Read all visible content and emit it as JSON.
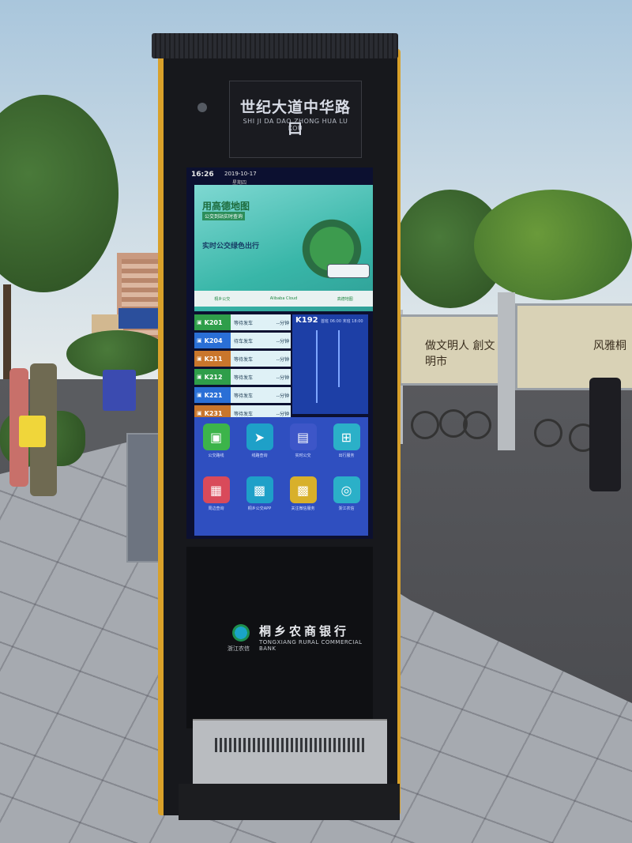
{
  "kiosk": {
    "stop_name_cn": "世纪大道中华路口",
    "stop_name_pinyin": "SHI JI DA DAO ZHONG HUA LU KOU",
    "screen": {
      "time": "16:26",
      "date": "2019-10-17",
      "weekday": "星期四",
      "banner": {
        "headline": "用高德地图",
        "tag": "公交到站实时查询",
        "subline": "实时公交绿色出行",
        "footer_items": [
          "桐乡公交",
          "Alibaba Cloud",
          "高德地图"
        ]
      },
      "routes": [
        {
          "id": "K201",
          "wait": "--分钟",
          "status": "等待发车",
          "color": "#2f9e4a"
        },
        {
          "id": "K204",
          "wait": "--分钟",
          "status": "待车发车",
          "color": "#2a6fd6"
        },
        {
          "id": "K211",
          "wait": "--分钟",
          "status": "等待发车",
          "color": "#c9762c"
        },
        {
          "id": "K212",
          "wait": "--分钟",
          "status": "等待发车",
          "color": "#2f9e4a"
        },
        {
          "id": "K221",
          "wait": "--分钟",
          "status": "等待发车",
          "color": "#2a6fd6"
        },
        {
          "id": "K231",
          "wait": "--分钟",
          "status": "等待发车",
          "color": "#c9762c"
        }
      ],
      "selected_route": {
        "id": "K192",
        "hours": "首班 06:00 末班 18:00"
      },
      "apps": [
        {
          "label": "公交路线",
          "icon": "bus-icon",
          "color": "#3cb44a",
          "glyph": "▣"
        },
        {
          "label": "线路查询",
          "icon": "navigate-icon",
          "color": "#1ea0c8",
          "glyph": "➤"
        },
        {
          "label": "实时公交",
          "icon": "train-icon",
          "color": "#3d56c8",
          "glyph": "▤"
        },
        {
          "label": "出行服务",
          "icon": "service-icon",
          "color": "#2bb0c8",
          "glyph": "⊞"
        },
        {
          "label": "周边查询",
          "icon": "building-icon",
          "color": "#d94a5a",
          "glyph": "▦"
        },
        {
          "label": "桐乡公交APP",
          "icon": "qr-icon",
          "color": "#1ea0c8",
          "glyph": "▩"
        },
        {
          "label": "关注微信服务",
          "icon": "qr-icon",
          "color": "#d8b02a",
          "glyph": "▩"
        },
        {
          "label": "浙江农信",
          "icon": "logo-icon",
          "color": "#2bb0c8",
          "glyph": "◎"
        }
      ]
    },
    "ad": {
      "bank_cn": "桐乡农商银行",
      "bank_en": "TONGXIANG RURAL COMMERCIAL BANK",
      "bank_sub": "浙江农信"
    }
  },
  "background": {
    "wall_sign_left": "做文明人 創文明市",
    "wall_sign_right": "风雅桐"
  }
}
